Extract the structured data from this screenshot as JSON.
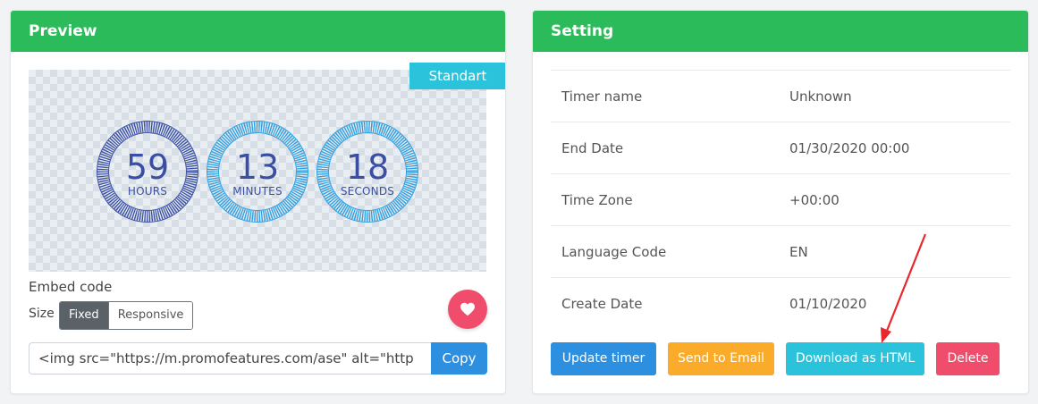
{
  "preview": {
    "header_title": "Preview",
    "header_color": "#2bbb5a",
    "badge_label": "Standart",
    "timer": [
      {
        "value": "59",
        "unit": "HOURS",
        "color": "#3a4fa3"
      },
      {
        "value": "13",
        "unit": "MINUTES",
        "color": "#2f9fe0"
      },
      {
        "value": "18",
        "unit": "SECONDS",
        "color": "#2f9fe0"
      }
    ],
    "embed_label": "Embed code",
    "size_label": "Size",
    "size_options": [
      "Fixed",
      "Responsive"
    ],
    "size_selected": "Fixed",
    "embed_code_value": "<img src=\"https://m.promofeatures.com/ase\" alt=\"http",
    "copy_label": "Copy",
    "favorite_icon": "heart-icon"
  },
  "setting": {
    "header_title": "Setting",
    "rows": [
      {
        "label": "Timer name",
        "value": "Unknown"
      },
      {
        "label": "End Date",
        "value": "01/30/2020 00:00"
      },
      {
        "label": "Time Zone",
        "value": "+00:00"
      },
      {
        "label": "Language Code",
        "value": "EN"
      },
      {
        "label": "Create Date",
        "value": "01/10/2020"
      }
    ],
    "buttons": {
      "update": "Update timer",
      "email": "Send to Email",
      "download": "Download as HTML",
      "delete": "Delete"
    }
  },
  "colors": {
    "green": "#2bbb5a",
    "blue": "#2d8fe0",
    "orange": "#fbab2a",
    "cyan": "#2bc3db",
    "red": "#ef4d6b"
  }
}
